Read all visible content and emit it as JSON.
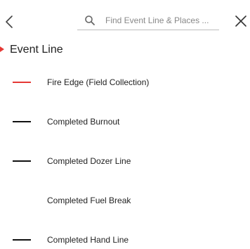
{
  "header": {
    "search_placeholder": "Find Event Line & Places ..."
  },
  "section": {
    "title": "Event Line",
    "marker_color": "#e53935"
  },
  "items": [
    {
      "label": "Fire Edge (Field Collection)",
      "color": "#e53935",
      "swatch": true
    },
    {
      "label": "Completed Burnout",
      "color": "#111111",
      "swatch": true
    },
    {
      "label": "Completed Dozer Line",
      "color": "#111111",
      "swatch": true
    },
    {
      "label": "Completed Fuel Break",
      "color": "",
      "swatch": false
    },
    {
      "label": "Completed Hand Line",
      "color": "#111111",
      "swatch": true
    }
  ]
}
